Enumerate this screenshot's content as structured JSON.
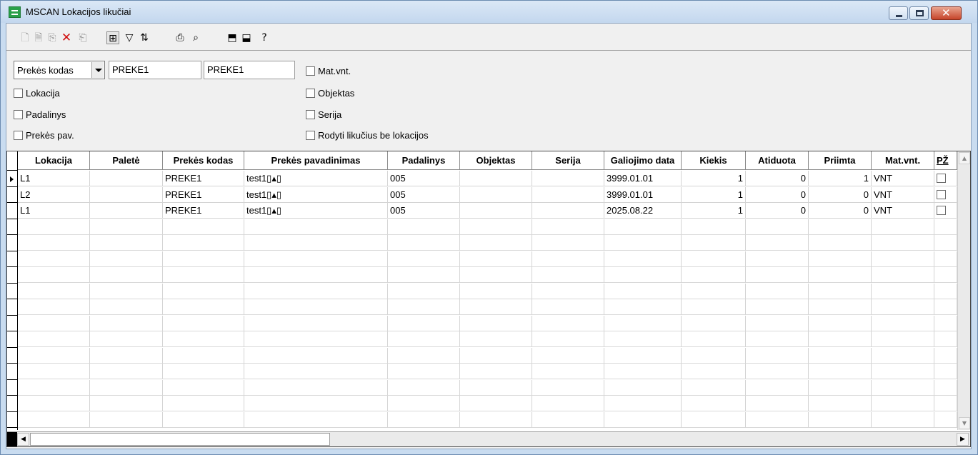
{
  "window": {
    "title": "MSCAN Lokacijos likučiai",
    "title_icon": "grid-list-icon",
    "controls": {
      "minimize_icon": "minimize-icon",
      "maximize_icon": "maximize-icon",
      "close_glyph": "✕"
    }
  },
  "toolbar": {
    "buttons": [
      {
        "icon": "new-doc-icon",
        "glyph": "🗋",
        "enabled": false
      },
      {
        "icon": "edit-doc-icon",
        "glyph": "🗎",
        "enabled": false
      },
      {
        "icon": "copy-record-icon",
        "glyph": "⎘",
        "enabled": false
      },
      {
        "icon": "delete-icon",
        "glyph": "✕",
        "enabled": true
      },
      {
        "icon": "paste-icon",
        "glyph": "⎗",
        "enabled": false
      },
      {
        "icon": "tree-view-icon",
        "glyph": "⊞",
        "enabled": true
      },
      {
        "icon": "filter-icon",
        "glyph": "▽",
        "enabled": true
      },
      {
        "icon": "sort-az-icon",
        "glyph": "⇅",
        "enabled": true
      },
      {
        "icon": "print-icon",
        "glyph": "⎙",
        "enabled": true
      },
      {
        "icon": "find-icon",
        "glyph": "⌕",
        "enabled": true
      },
      {
        "icon": "import-icon",
        "glyph": "⬒",
        "enabled": true
      },
      {
        "icon": "export-icon",
        "glyph": "⬓",
        "enabled": true
      },
      {
        "icon": "help-icon",
        "glyph": "?",
        "enabled": true
      }
    ]
  },
  "filters": {
    "field_select": {
      "value": "Prekės kodas"
    },
    "from_value": "PREKE1",
    "to_value": "PREKE1",
    "checkboxes_left": [
      {
        "label": "Lokacija",
        "checked": false
      },
      {
        "label": "Padalinys",
        "checked": false
      },
      {
        "label": "Prekės pav.",
        "checked": false
      }
    ],
    "checkboxes_right": [
      {
        "label": "Mat.vnt.",
        "checked": false
      },
      {
        "label": "Objektas",
        "checked": false
      },
      {
        "label": "Serija",
        "checked": false
      },
      {
        "label": "Rodyti likučius be lokacijos",
        "checked": false
      }
    ]
  },
  "grid": {
    "columns": [
      "Lokacija",
      "Paletė",
      "Prekės kodas",
      "Prekės pavadinimas",
      "Padalinys",
      "Objektas",
      "Serija",
      "Galiojimo data",
      "Kiekis",
      "Atiduota",
      "Priimta",
      "Mat.vnt.",
      "PŽ"
    ],
    "rows": [
      {
        "lokacija": "L1",
        "palete": "",
        "kodas": "PREKE1",
        "pavadinimas": "test1▯▴▯",
        "padalinys": "005",
        "objektas": "",
        "serija": "",
        "data": "3999.01.01",
        "kiekis": "1",
        "atiduota": "0",
        "priimta": "1",
        "matvnt": "VNT",
        "pz": false,
        "current": true
      },
      {
        "lokacija": "L2",
        "palete": "",
        "kodas": "PREKE1",
        "pavadinimas": "test1▯▴▯",
        "padalinys": "005",
        "objektas": "",
        "serija": "",
        "data": "3999.01.01",
        "kiekis": "1",
        "atiduota": "0",
        "priimta": "0",
        "matvnt": "VNT",
        "pz": false,
        "current": false
      },
      {
        "lokacija": "L1",
        "palete": "",
        "kodas": "PREKE1",
        "pavadinimas": "test1▯▴▯",
        "padalinys": "005",
        "objektas": "",
        "serija": "",
        "data": "2025.08.22",
        "kiekis": "1",
        "atiduota": "0",
        "priimta": "0",
        "matvnt": "VNT",
        "pz": false,
        "current": false
      }
    ]
  }
}
